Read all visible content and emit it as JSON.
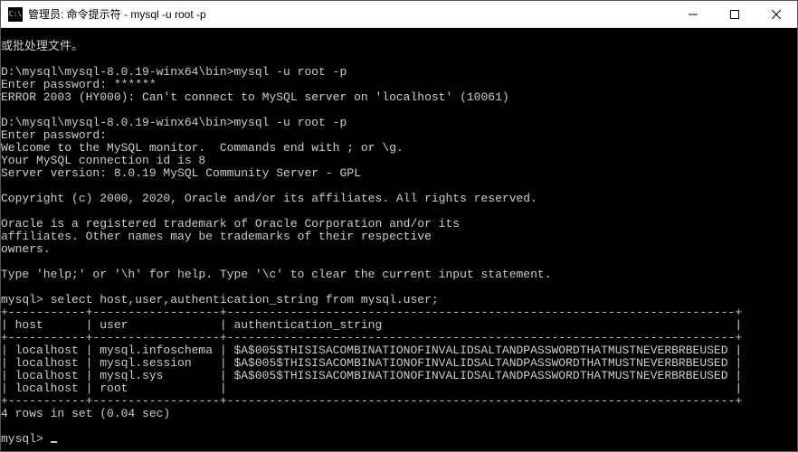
{
  "window": {
    "title": "管理员: 命令提示符 - mysql  -u root -p"
  },
  "terminal": {
    "intro_tail": "或批处理文件。",
    "blank": "",
    "attempt1": {
      "prompt_line": "D:\\mysql\\mysql-8.0.19-winx64\\bin>mysql -u root -p",
      "enter_pwd": "Enter password: ******",
      "error": "ERROR 2003 (HY000): Can't connect to MySQL server on 'localhost' (10061)"
    },
    "attempt2": {
      "prompt_line": "D:\\mysql\\mysql-8.0.19-winx64\\bin>mysql -u root -p",
      "enter_pwd": "Enter password:",
      "welcome1": "Welcome to the MySQL monitor.  Commands end with ; or \\g.",
      "welcome2": "Your MySQL connection id is 8",
      "welcome3": "Server version: 8.0.19 MySQL Community Server - GPL",
      "copyright": "Copyright (c) 2000, 2020, Oracle and/or its affiliates. All rights reserved.",
      "trademark1": "Oracle is a registered trademark of Oracle Corporation and/or its",
      "trademark2": "affiliates. Other names may be trademarks of their respective",
      "trademark3": "owners.",
      "help_line": "Type 'help;' or '\\h' for help. Type '\\c' to clear the current input statement."
    },
    "query": {
      "prompt": "mysql> select host,user,authentication_string from mysql.user;",
      "border": "+-----------+------------------+------------------------------------------------------------------------+",
      "header": "| host      | user             | authentication_string                                                  |",
      "rows": [
        "| localhost | mysql.infoschema | $A$005$THISISACOMBINATIONOFINVALIDSALTANDPASSWORDTHATMUSTNEVERBRBEUSED |",
        "| localhost | mysql.session    | $A$005$THISISACOMBINATIONOFINVALIDSALTANDPASSWORDTHATMUSTNEVERBRBEUSED |",
        "| localhost | mysql.sys        | $A$005$THISISACOMBINATIONOFINVALIDSALTANDPASSWORDTHATMUSTNEVERBRBEUSED |",
        "| localhost | root             |                                                                        |"
      ],
      "footer": "4 rows in set (0.04 sec)"
    },
    "current_prompt": "mysql> "
  },
  "table_data": {
    "columns": [
      "host",
      "user",
      "authentication_string"
    ],
    "rows": [
      {
        "host": "localhost",
        "user": "mysql.infoschema",
        "authentication_string": "$A$005$THISISACOMBINATIONOFINVALIDSALTANDPASSWORDTHATMUSTNEVERBRBEUSED"
      },
      {
        "host": "localhost",
        "user": "mysql.session",
        "authentication_string": "$A$005$THISISACOMBINATIONOFINVALIDSALTANDPASSWORDTHATMUSTNEVERBRBEUSED"
      },
      {
        "host": "localhost",
        "user": "mysql.sys",
        "authentication_string": "$A$005$THISISACOMBINATIONOFINVALIDSALTANDPASSWORDTHATMUSTNEVERBRBEUSED"
      },
      {
        "host": "localhost",
        "user": "root",
        "authentication_string": ""
      }
    ],
    "row_count": 4,
    "elapsed_sec": 0.04
  }
}
